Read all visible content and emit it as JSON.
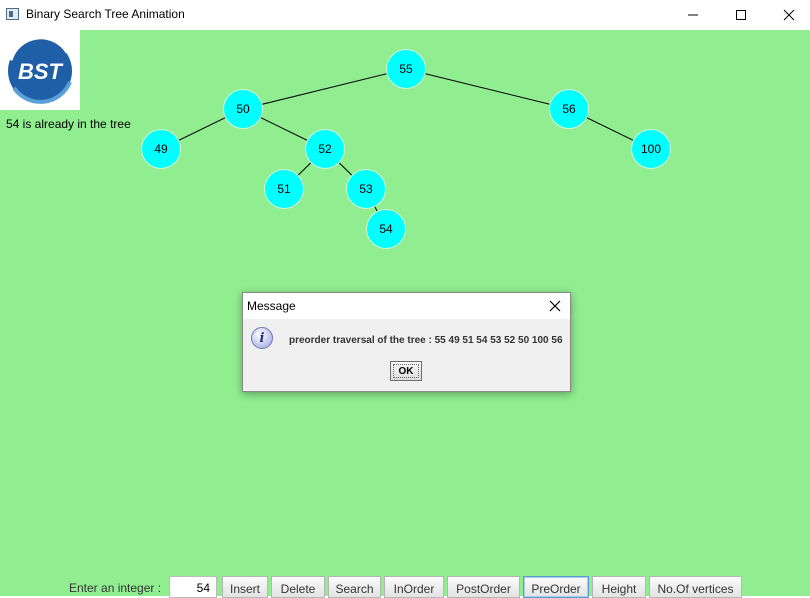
{
  "window": {
    "title": "Binary Search Tree Animation"
  },
  "logo": {
    "text": "BST"
  },
  "status_text": "54 is already in the tree",
  "tree": {
    "nodes": [
      {
        "id": "n55",
        "label": "55"
      },
      {
        "id": "n50",
        "label": "50"
      },
      {
        "id": "n56",
        "label": "56"
      },
      {
        "id": "n49",
        "label": "49"
      },
      {
        "id": "n52",
        "label": "52"
      },
      {
        "id": "n100",
        "label": "100"
      },
      {
        "id": "n51",
        "label": "51"
      },
      {
        "id": "n53",
        "label": "53"
      },
      {
        "id": "n54",
        "label": "54"
      }
    ]
  },
  "dialog": {
    "title": "Message",
    "message": "preorder traversal of the tree : 55 49 51 54 53 52 50 100 56",
    "ok_label": "OK"
  },
  "controls": {
    "label": "Enter an integer :",
    "input_value": "54",
    "buttons": [
      {
        "label": "Insert"
      },
      {
        "label": "Delete"
      },
      {
        "label": "Search"
      },
      {
        "label": "InOrder"
      },
      {
        "label": "PostOrder"
      },
      {
        "label": "PreOrder",
        "active": true
      },
      {
        "label": "Height"
      },
      {
        "label": "No.Of vertices"
      }
    ]
  },
  "colors": {
    "canvas_bg": "#90ee90",
    "node_fill": "#00ffff",
    "logo_blue": "#1f5fa8"
  }
}
